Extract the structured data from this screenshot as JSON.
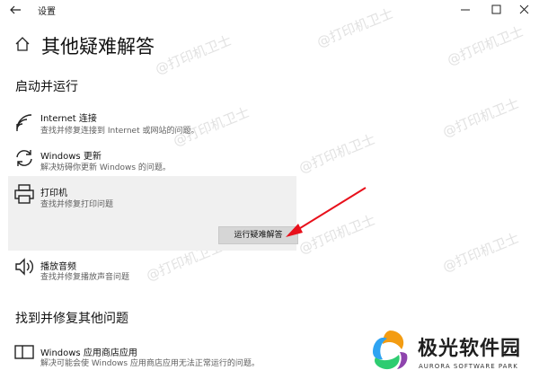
{
  "window": {
    "title": "设置"
  },
  "page": {
    "title": "其他疑难解答"
  },
  "sections": {
    "run": "启动并运行",
    "other": "找到并修复其他问题"
  },
  "items": {
    "internet": {
      "name": "Internet 连接",
      "desc": "查找并修复连接到 Internet 或网站的问题。",
      "icon": "wifi-icon"
    },
    "update": {
      "name": "Windows 更新",
      "desc": "解决妨碍你更新 Windows 的问题。",
      "icon": "refresh-icon"
    },
    "printer": {
      "name": "打印机",
      "desc": "查找并修复打印问题",
      "button": "运行疑难解答",
      "icon": "printer-icon"
    },
    "audio": {
      "name": "播放音频",
      "desc": "查找并修复播放声音问题",
      "icon": "speaker-icon"
    },
    "store": {
      "name": "Windows 应用商店应用",
      "desc": "解决可能会使 Windows 应用商店应用无法正常运行的问题。",
      "icon": "app-window-icon"
    }
  },
  "watermark": {
    "text": "@打印机卫士"
  },
  "logo": {
    "cn": "极光软件园",
    "en": "AURORA SOFTWARE PARK"
  },
  "colors": {
    "accent_arrow": "#e8101b",
    "selected_bg": "#f0f0f0",
    "button_bg": "#d6d6d6"
  }
}
